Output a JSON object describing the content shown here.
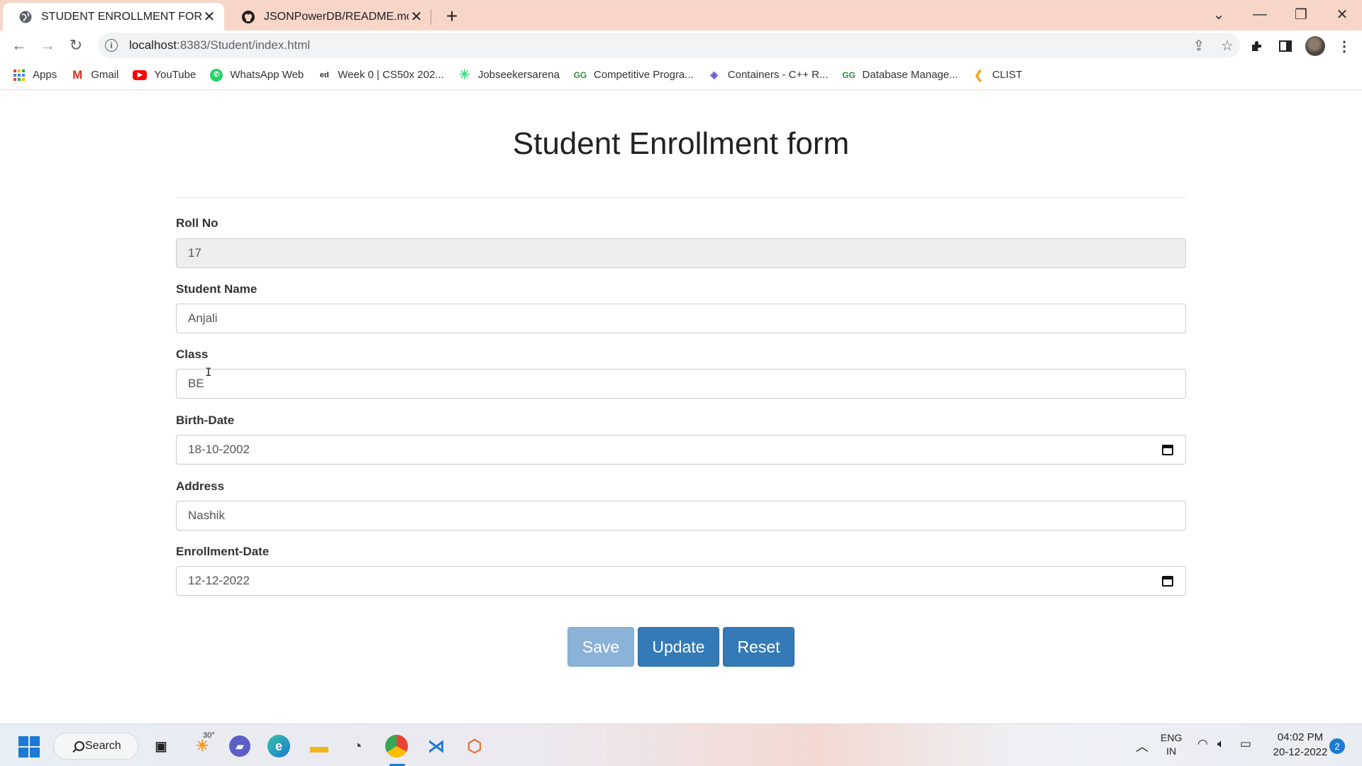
{
  "browser": {
    "tabs": [
      {
        "title": "STUDENT ENROLLMENT FORM",
        "active": true
      },
      {
        "title": "JSONPowerDB/README.md at m",
        "active": false
      }
    ],
    "url_host": "localhost",
    "url_rest": ":8383/Student/index.html",
    "bookmarks": [
      {
        "label": "Apps",
        "icon": "apps-grid-icon"
      },
      {
        "label": "Gmail",
        "icon": "gmail-icon"
      },
      {
        "label": "YouTube",
        "icon": "youtube-icon"
      },
      {
        "label": "WhatsApp Web",
        "icon": "whatsapp-icon"
      },
      {
        "label": "Week 0 | CS50x 202...",
        "icon": "cs50-icon"
      },
      {
        "label": "Jobseekersarena",
        "icon": "jobseekersarena-icon"
      },
      {
        "label": "Competitive Progra...",
        "icon": "geeksforgeeks-icon"
      },
      {
        "label": "Containers - C++ R...",
        "icon": "cplusplus-icon"
      },
      {
        "label": "Database Manage...",
        "icon": "geeksforgeeks-icon"
      },
      {
        "label": "CLIST",
        "icon": "clist-icon"
      }
    ]
  },
  "form": {
    "title": "Student Enrollment form",
    "fields": [
      {
        "label": "Roll No",
        "value": "17",
        "disabled": true
      },
      {
        "label": "Student Name",
        "value": "Anjali"
      },
      {
        "label": "Class",
        "value": "BE"
      },
      {
        "label": "Birth-Date",
        "value": "18-10-2002",
        "type": "date"
      },
      {
        "label": "Address",
        "value": "Nashik"
      },
      {
        "label": "Enrollment-Date",
        "value": "12-12-2022",
        "type": "date"
      }
    ],
    "buttons": {
      "save": "Save",
      "update": "Update",
      "reset": "Reset"
    }
  },
  "taskbar": {
    "search_label": "Search",
    "weather_temp": "30°",
    "language": "ENG",
    "region": "IN",
    "time": "04:02 PM",
    "date": "20-12-2022",
    "notification_count": "2"
  },
  "colors": {
    "tabstrip": "#f7d6c8",
    "button_primary": "#337ab7",
    "button_disabled": "#8bb3d8",
    "disabled_field": "#eeeeee"
  }
}
